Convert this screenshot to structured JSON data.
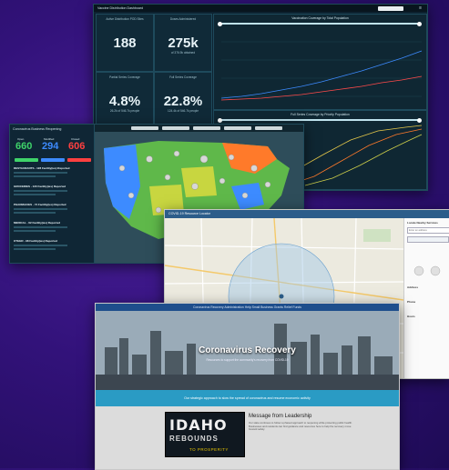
{
  "vaccine_dashboard": {
    "window_title": "Vaccine Distribution Dashboard",
    "kpis": [
      {
        "label": "Active Distribution POD Sites",
        "value": "188",
        "sub": ""
      },
      {
        "label": "Doses Administered",
        "value": "275k",
        "sub": "of 376.9k obtained"
      },
      {
        "label": "Partial Series Coverage",
        "value": "4.8%",
        "sub": "26.2k of 546.7k people"
      },
      {
        "label": "Full Series Coverage",
        "value": "22.8%",
        "sub": "124.4k of 546.7k people"
      }
    ],
    "chart_top_title": "Vaccination Coverage by Total Population",
    "chart_bottom_title": "Full Series Coverage by Priority Population",
    "tab_active": "Metrics",
    "accent": "#2ad4ff"
  },
  "business_reopening": {
    "title": "Coronavirus Business Reopening",
    "counts": [
      {
        "label": "Open",
        "value": "660",
        "color": "#3fd46a"
      },
      {
        "label": "Modified",
        "value": "294",
        "color": "#3d8bff"
      },
      {
        "label": "Closed",
        "value": "606",
        "color": "#ff4040"
      }
    ],
    "categories": [
      "RESTAURANTS - 128 Facility(ies) Reported",
      "GROCERIES - 120 Facility(ies) Reported",
      "PHARMACIES - 74 Facility(ies) Reported",
      "MEDICAL - 62 Facility(ies) Reported",
      "OTHER - 98 Facility(ies) Reported"
    ]
  },
  "nearby_services": {
    "title": "COVID-19 Resource Locator",
    "panel_title": "Locate Nearby Services",
    "search_placeholder": "Enter an address",
    "labels": [
      "Address",
      "Phone",
      "Hours"
    ]
  },
  "recovery_site": {
    "nav": "Coronavirus Recovery   Administration Help   Small Business Grants   Relief Funds",
    "title": "Coronavirus Recovery",
    "subtitle": "Resources to support the community's recovery from COVID-19",
    "band_text": "Our strategic approach to slow the spread of coronavirus and resume economic activity",
    "logo_line1": "IDAHO",
    "logo_line2": "REBOUNDS",
    "logo_line3": "TO PROSPERITY",
    "message_heading": "Message from Leadership",
    "message_body": "Our state continues to follow a phased approach to reopening while protecting public health. Businesses and residents can find guidance and resources here to help the recovery move forward safely."
  }
}
